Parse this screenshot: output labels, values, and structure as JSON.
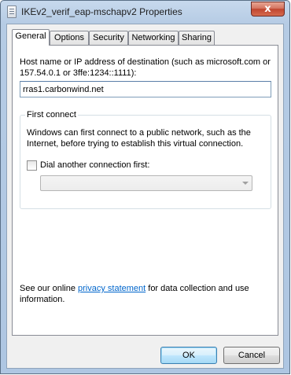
{
  "window": {
    "title": "IKEv2_verif_eap-mschapv2 Properties",
    "close_glyph": "x"
  },
  "tabs": [
    {
      "label": "General",
      "active": true
    },
    {
      "label": "Options",
      "active": false
    },
    {
      "label": "Security",
      "active": false
    },
    {
      "label": "Networking",
      "active": false
    },
    {
      "label": "Sharing",
      "active": false
    }
  ],
  "general": {
    "host_label": "Host name or IP address of destination (such as microsoft.com or 157.54.0.1 or 3ffe:1234::1111):",
    "host_value": "rras1.carbonwind.net",
    "first_connect": {
      "legend": "First connect",
      "description": "Windows can first connect to a public network, such as the Internet, before trying to establish this virtual connection.",
      "dial_checkbox_label": "Dial another connection first:",
      "dial_checked": false,
      "dial_select_value": ""
    },
    "privacy": {
      "before": "See our online ",
      "link": "privacy statement",
      "after": " for data collection and use information."
    }
  },
  "buttons": {
    "ok": "OK",
    "cancel": "Cancel"
  },
  "icons": {
    "title_icon": "vpn-connection-icon",
    "close_icon": "close-icon",
    "dropdown_icon": "chevron-down-icon"
  },
  "colors": {
    "link": "#0066cc",
    "close_button": "#c0452f",
    "default_button_border": "#3c7fb1"
  }
}
